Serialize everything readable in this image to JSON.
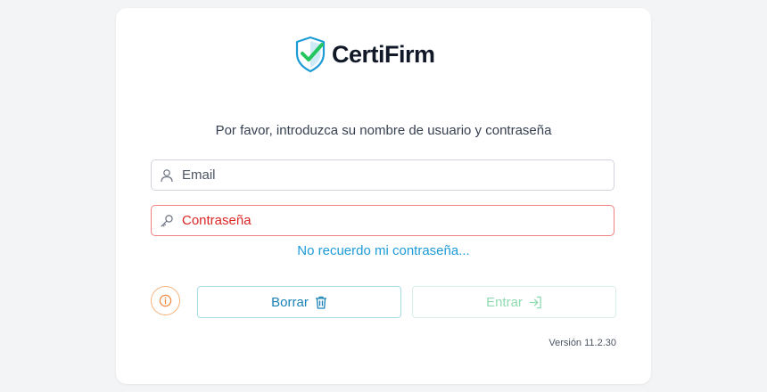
{
  "brand": {
    "name": "CertiFirm"
  },
  "login": {
    "prompt": "Por favor, introduzca su nombre de usuario y contraseña",
    "email_placeholder": "Email",
    "password_placeholder": "Contraseña",
    "forgot_link": "No recuerdo mi contraseña..."
  },
  "actions": {
    "clear_label": "Borrar",
    "enter_label": "Entrar"
  },
  "footer": {
    "version": "Versión 11.2.30"
  },
  "colors": {
    "brand_blue": "#1d9bd7",
    "check_green": "#22c55e",
    "error_red": "#dc2626",
    "info_orange": "#f0883e",
    "enter_disabled_green": "#8fdcb1"
  },
  "icons": {
    "logo": "shield-check-icon",
    "email": "user-icon",
    "password": "key-icon",
    "info": "info-icon",
    "clear": "trash-icon",
    "enter": "sign-in-icon"
  }
}
